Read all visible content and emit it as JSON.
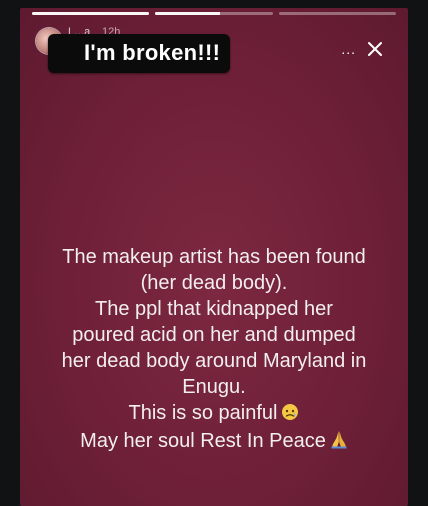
{
  "story": {
    "caption": "I'm broken!!!",
    "username": "L...a",
    "time_ago": "12h",
    "more_label": "...",
    "text_lines": [
      "The makeup artist has been found",
      "(her dead body).",
      "The ppl that kidnapped her",
      "poured acid on her and dumped",
      "her dead body around Maryland in",
      "Enugu.",
      "This is so painful",
      "May her soul Rest In Peace"
    ],
    "progress": [
      1.0,
      0.55,
      0.0
    ],
    "background_color": "#6e2038",
    "icons": {
      "more": "more-icon",
      "close": "close-icon",
      "sad_face": "downcast-face-emoji",
      "praying_hands": "folded-hands-emoji"
    }
  }
}
